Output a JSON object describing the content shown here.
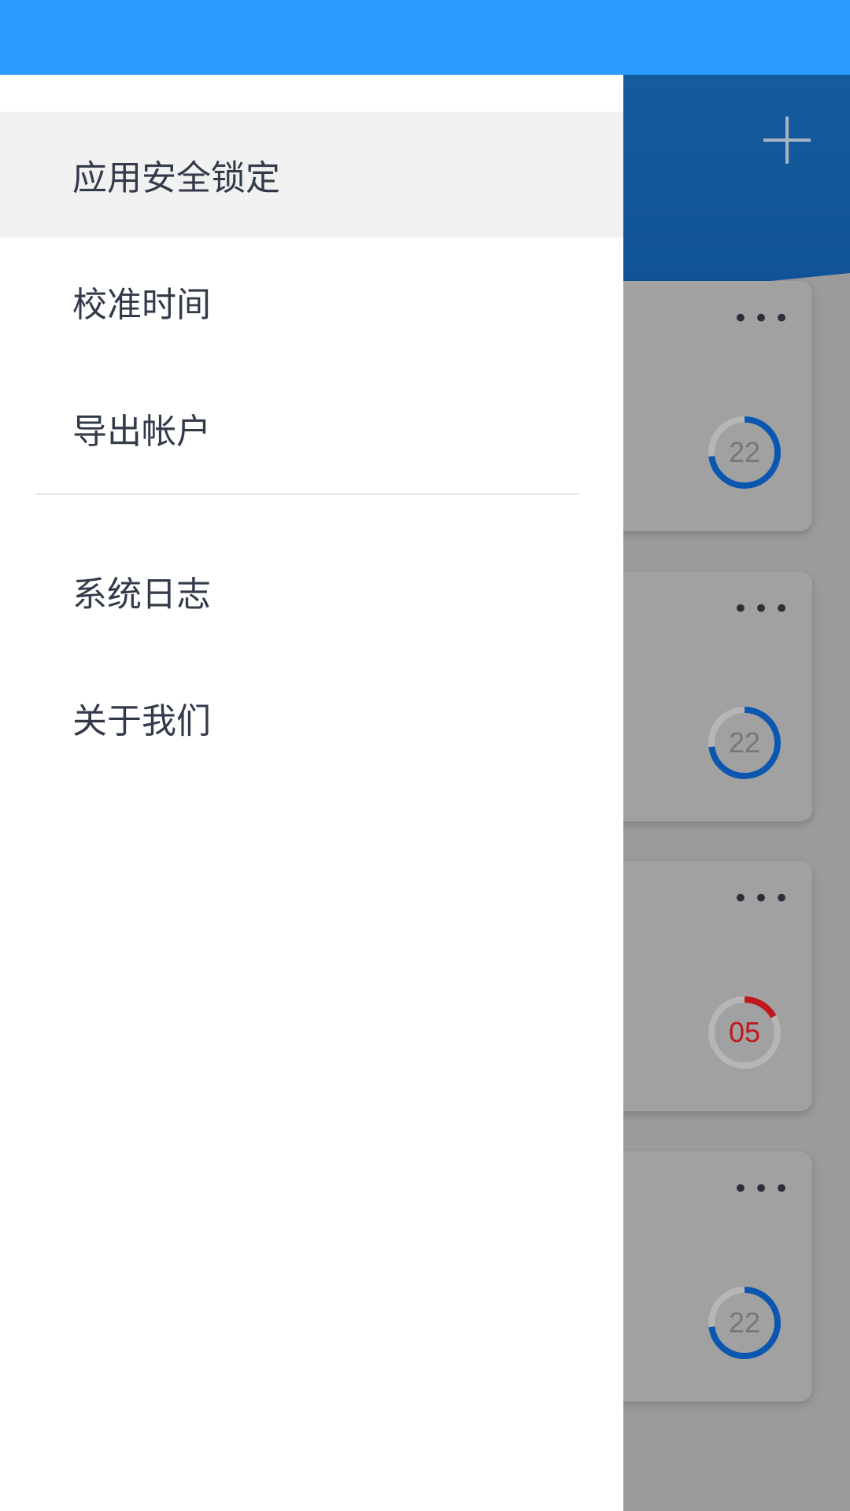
{
  "drawer": {
    "items": [
      {
        "label": "应用安全锁定",
        "active": true
      },
      {
        "label": "校准时间",
        "active": false
      },
      {
        "label": "导出帐户",
        "active": false
      },
      {
        "label": "系统日志",
        "active": false
      },
      {
        "label": "关于我们",
        "active": false
      }
    ]
  },
  "cards": [
    {
      "more": "•••",
      "countdown": "22",
      "ring_fraction": 0.73,
      "state": "normal"
    },
    {
      "more": "•••",
      "countdown": "22",
      "ring_fraction": 0.73,
      "state": "normal"
    },
    {
      "more": "•••",
      "countdown": "05",
      "ring_fraction": 0.17,
      "state": "warning"
    },
    {
      "more": "•••",
      "countdown": "22",
      "ring_fraction": 0.73,
      "state": "normal"
    }
  ],
  "colors": {
    "status_bar": "#2b9bfd",
    "ring_normal": "#0b57b0",
    "ring_warning": "#c0171c",
    "ring_track": "#b6b6b6"
  }
}
